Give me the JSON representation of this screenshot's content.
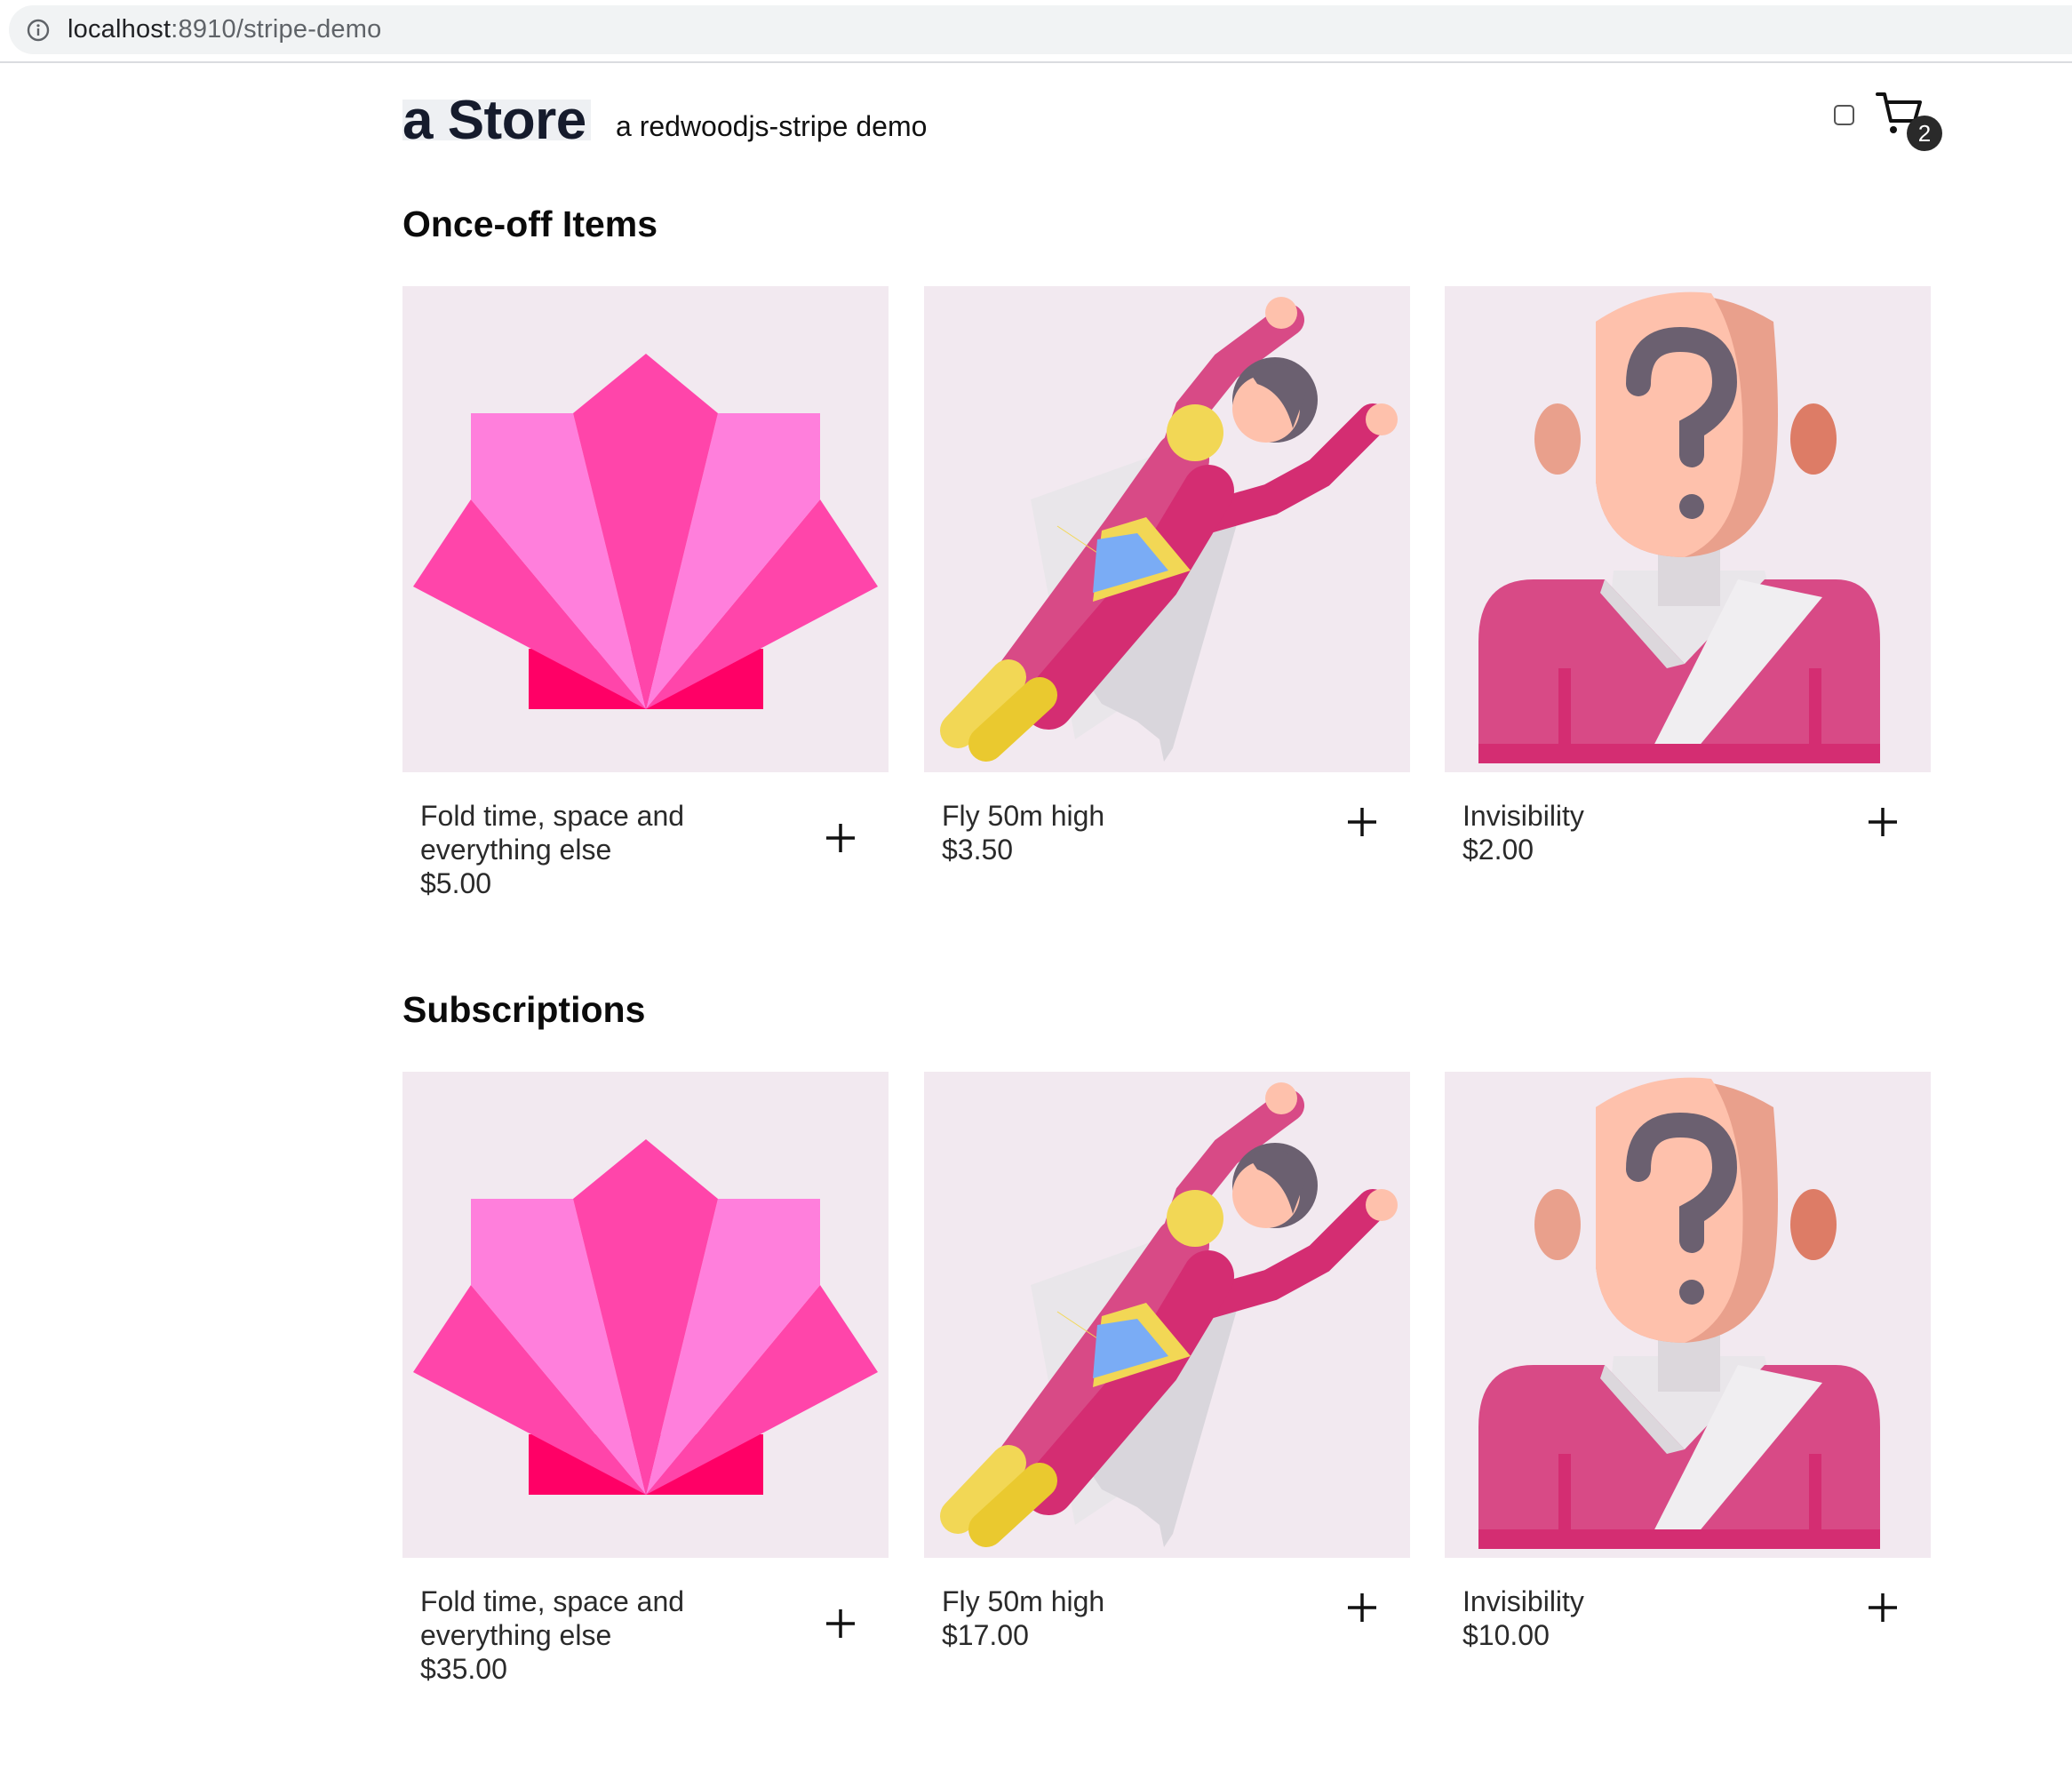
{
  "browser": {
    "url_host": "localhost",
    "url_rest": ":8910/stripe-demo"
  },
  "header": {
    "brand": "a Store",
    "tagline": "a redwoodjs-stripe demo",
    "cart_count": "2"
  },
  "sections": [
    {
      "title": "Once-off Items",
      "products": [
        {
          "name": "Fold time, space and everything else",
          "price": "$5.00",
          "icon": "origami-fan-icon"
        },
        {
          "name": "Fly 50m high",
          "price": "$3.50",
          "icon": "flying-superhero-icon"
        },
        {
          "name": "Invisibility",
          "price": "$2.00",
          "icon": "mystery-person-icon"
        }
      ]
    },
    {
      "title": "Subscriptions",
      "products": [
        {
          "name": "Fold time, space and everything else",
          "price": "$35.00",
          "icon": "origami-fan-icon"
        },
        {
          "name": "Fly 50m high",
          "price": "$17.00",
          "icon": "flying-superhero-icon"
        },
        {
          "name": "Invisibility",
          "price": "$10.00",
          "icon": "mystery-person-icon"
        }
      ]
    }
  ],
  "colors": {
    "card_background": "#f2e9f0",
    "fan_light": "#ff7fdc",
    "fan_mid": "#ff45aa",
    "fan_base": "#ff0066",
    "suit": "#d84a86",
    "skin": "#fec1ac",
    "hair": "#6b6070"
  }
}
